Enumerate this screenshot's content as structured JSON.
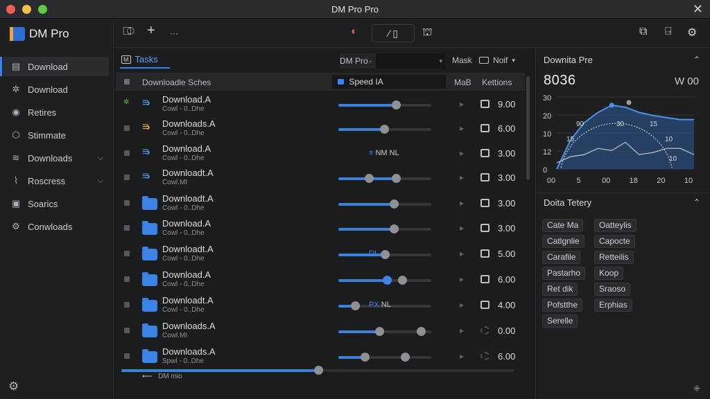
{
  "window": {
    "title": "DM Pro Pro"
  },
  "brand": {
    "name": "DM Pro"
  },
  "sidebar": {
    "items": [
      {
        "label": "Download",
        "icon": "download-icon",
        "glyph": "▤",
        "active": true
      },
      {
        "label": "Download",
        "icon": "spinner-icon",
        "glyph": "✲"
      },
      {
        "label": "Retires",
        "icon": "clock-icon",
        "glyph": "◉"
      },
      {
        "label": "Stimmate",
        "icon": "box-icon",
        "glyph": "⬡"
      },
      {
        "label": "Downloads",
        "icon": "layers-icon",
        "glyph": "≋",
        "chevron": "⌵"
      },
      {
        "label": "Roscress",
        "icon": "share-icon",
        "glyph": "⌇",
        "chevron": "⌵"
      },
      {
        "label": "Soarics",
        "icon": "image-icon",
        "glyph": "▣"
      },
      {
        "label": "Conwloads",
        "icon": "gear-icon",
        "glyph": "⚙"
      }
    ]
  },
  "toolbar": {
    "left": [
      "⎄",
      "+",
      "···"
    ],
    "center_left": "◐",
    "segment": "⁄ ▯",
    "center_right": "⛫",
    "right": [
      "⧉",
      "⍈",
      "⚙"
    ]
  },
  "main": {
    "tab_icon": "M",
    "tab": "Tasks",
    "select_label": "DM Pro",
    "select_mark": "-",
    "select_arrow": "▾",
    "col_mask": "Mask",
    "col_noti": "Noif",
    "col_noti_arrow": "▾",
    "header": {
      "name": "Downloadle Sches",
      "speed": "Speed IA",
      "mab": "MaB",
      "kett": "Kettions"
    },
    "rows": [
      {
        "name": "Download.A",
        "sub": "Cowl - 0..Dhe",
        "icon": "arrow",
        "check": "✲",
        "progress": 0.62,
        "knobs": [
          0.62
        ],
        "val": "9.00"
      },
      {
        "name": "Downloads.A",
        "sub": "Cowl - 0..Dhe",
        "icon": "arrow-orange",
        "progress": 0.49,
        "knobs": [
          0.49
        ],
        "val": "6.00"
      },
      {
        "name": "Download.A",
        "sub": "Cowl - 0..Dhe",
        "icon": "arrow",
        "badge_icon": "≡",
        "badge_text": "NM NL",
        "val": "3.00"
      },
      {
        "name": "Downloadt.A",
        "sub": "Cowl.MI",
        "icon": "arrow",
        "progress": 0.62,
        "knobs": [
          0.33,
          0.62
        ],
        "val": "3.00"
      },
      {
        "name": "Downloadt.A",
        "sub": "Cowl - 0..Dhe",
        "icon": "folder",
        "progress": 0.6,
        "knobs": [
          0.6
        ],
        "val": "3.00"
      },
      {
        "name": "Download.A",
        "sub": "Cowl - 0..Dhe",
        "icon": "folder",
        "progress": 0.6,
        "knobs": [
          0.6
        ],
        "val": "3.00"
      },
      {
        "name": "Downloadt.A",
        "sub": "Cowl - 0..Dhe",
        "icon": "folder",
        "progress": 0.5,
        "knobs": [
          0.5
        ],
        "badge_text_only": "DL",
        "val": "5.00"
      },
      {
        "name": "Download.A",
        "sub": "Cowl - 0..Dhe",
        "icon": "folder",
        "progress": 0.52,
        "knobs": [
          0.52,
          0.69
        ],
        "blue_knob": 0,
        "val": "6.00"
      },
      {
        "name": "Downloadt.A",
        "sub": "Cowl - 0..Dhe",
        "icon": "folder",
        "progress": 0.18,
        "knobs": [
          0.18
        ],
        "badge_icon": "PX",
        "badge_text": "NL",
        "val": "4.00"
      },
      {
        "name": "Downloads.A",
        "sub": "Cowl.MI",
        "icon": "folder",
        "progress": 0.44,
        "knobs": [
          0.44,
          0.89
        ],
        "val": "0.00",
        "dim": true
      },
      {
        "name": "Downloads.A",
        "sub": "Spwl - 0..Dhe",
        "icon": "folder",
        "progress": 0.28,
        "knobs": [
          0.28,
          0.72
        ],
        "val": "6.00",
        "dim": true
      }
    ],
    "status": "DM mio",
    "status_arrow": "⟵",
    "play_glyph": "▶",
    "h_scroll": 0.5
  },
  "right_panel": {
    "section1": "Downita Pre",
    "value": "8036",
    "value_right": "W 00",
    "caret": "⌃",
    "section2": "Doita Tetery",
    "chips": [
      [
        "Cate Ma",
        "Oatteylis"
      ],
      [
        "Catlgnlie",
        "Capocte"
      ],
      [
        "Carafile",
        "Retteilis"
      ],
      [
        "Pastarho",
        "Koop"
      ],
      [
        "Ret dik",
        "Sraoso"
      ],
      [
        "Pofstthe",
        "Erphias"
      ],
      [
        "Serelle"
      ]
    ]
  },
  "chart_data": {
    "type": "area",
    "y_ticks": [
      "30",
      "20",
      "10",
      "12",
      "0"
    ],
    "x_ticks": [
      "00",
      "5",
      "00",
      "18",
      "20",
      "10"
    ],
    "gauge_labels": [
      "90",
      "30",
      "15",
      "15",
      "10",
      "10"
    ],
    "series": [
      {
        "values": [
          0,
          28,
          45,
          55,
          62,
          60,
          55,
          52,
          50,
          48,
          48
        ]
      },
      {
        "values": [
          6,
          12,
          14,
          20,
          18,
          26,
          14,
          16,
          20,
          20,
          14
        ]
      }
    ],
    "colors": {
      "area": "#2b5b99",
      "line": "#4d93ea",
      "line2": "#b8bec6",
      "gauge": "#c9ccd1"
    },
    "grid": true
  },
  "window_controls": {
    "close": "✕"
  },
  "footer": {
    "gear": "⚙",
    "corner": "⁜"
  }
}
